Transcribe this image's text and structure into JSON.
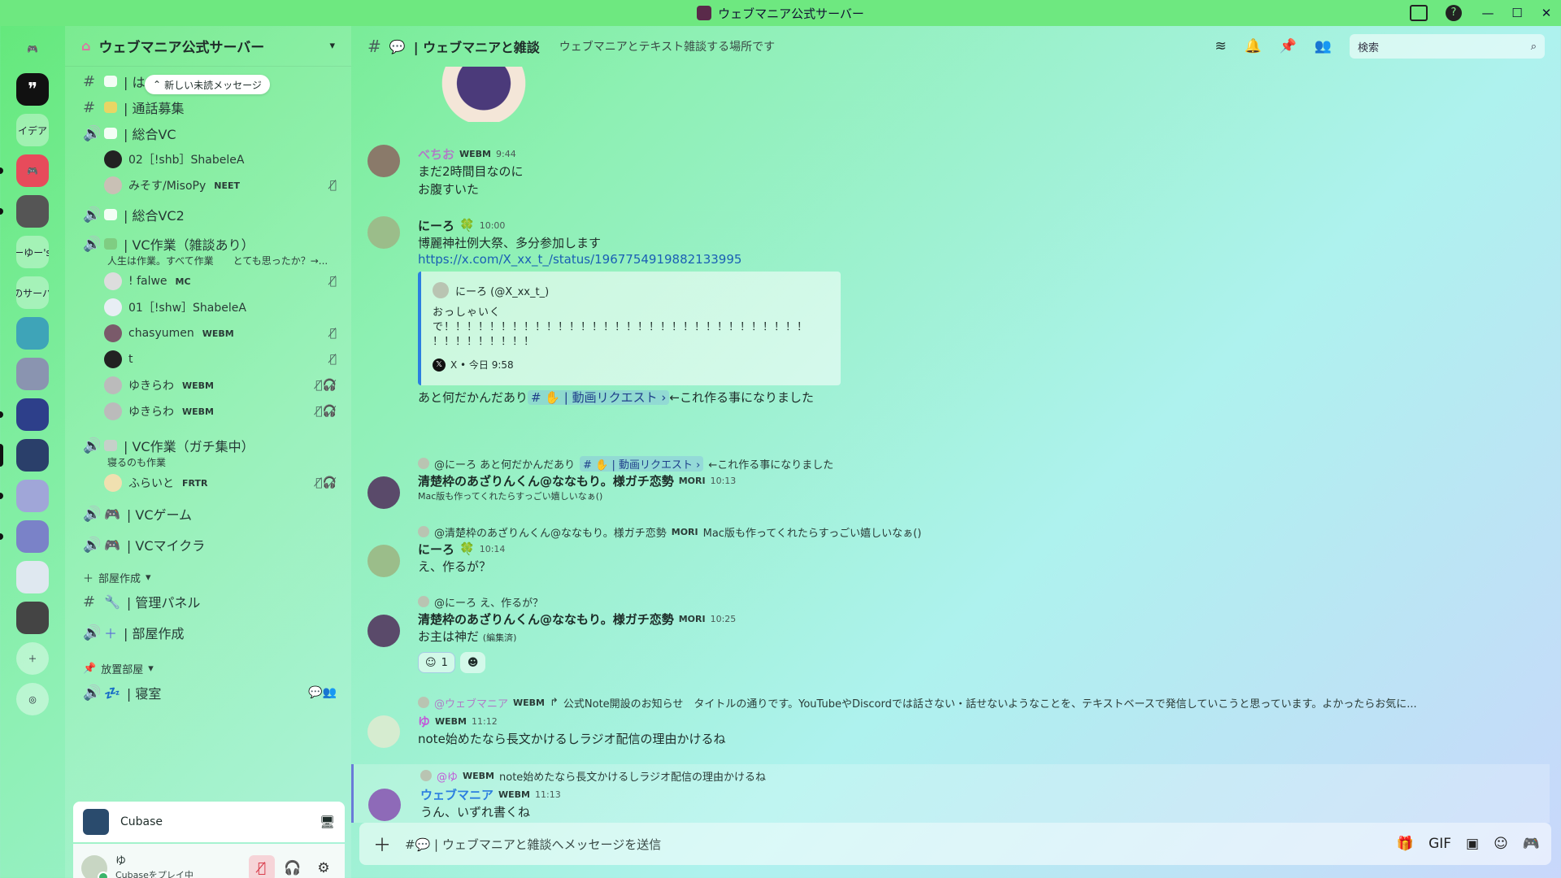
{
  "window": {
    "title": "ウェブマニア公式サーバー"
  },
  "rail": {
    "items": [
      "イデア",
      "ーゆー's",
      "のサーバ"
    ]
  },
  "server": {
    "name": "ウェブマニア公式サーバー",
    "unread_pill": "新しい未読メッセージ"
  },
  "channels": [
    {
      "type": "text",
      "label": "| は"
    },
    {
      "type": "text",
      "label": "| 通話募集"
    },
    {
      "type": "voice",
      "label": "| 総合VC"
    },
    {
      "type": "voice",
      "label": "| 総合VC2"
    },
    {
      "type": "voice",
      "label": "| VC作業（雑談あり）",
      "status": "人生は作業。すべて作業　　とても思ったか？→..."
    },
    {
      "type": "voice",
      "label": "| VC作業（ガチ集中）",
      "status": "寝るのも作業"
    },
    {
      "type": "voice",
      "label": "| VCゲーム"
    },
    {
      "type": "voice",
      "label": "| VCマイクラ"
    },
    {
      "type": "text",
      "label": "| 管理パネル"
    },
    {
      "type": "voice",
      "label": "| 部屋作成"
    },
    {
      "type": "voice",
      "label": "| 寝室"
    }
  ],
  "voice_users": {
    "vc1": [
      {
        "name": "02［!shb］ShabeleA",
        "tag": ""
      },
      {
        "name": "みそす/MisoPy",
        "tag": "NEET"
      }
    ],
    "vc3": [
      {
        "name": "! falwe",
        "tag": "MC"
      },
      {
        "name": "01［!shw］ShabeleA",
        "tag": ""
      },
      {
        "name": "chasyumen",
        "tag": "WEBM"
      },
      {
        "name": "t",
        "tag": ""
      },
      {
        "name": "ゆきらわ",
        "tag": "WEBM"
      },
      {
        "name": "ゆきらわ",
        "tag": "WEBM"
      }
    ],
    "vc4": [
      {
        "name": "ふらいと",
        "tag": "FRTR"
      }
    ]
  },
  "categories": {
    "room_create": "部屋作成",
    "free": "放置部屋"
  },
  "activity": {
    "app": "Cubase"
  },
  "user": {
    "name": "ゆ",
    "status": "Cubaseをプレイ中"
  },
  "topbar": {
    "channel": "| ウェブマニアと雑談",
    "topic": "ウェブマニアとテキスト雑談する場所です",
    "search_placeholder": "検索"
  },
  "messages": [
    {
      "author": "べちお",
      "badge": "WEBM",
      "time": "9:44",
      "lines": [
        "まだ2時間目なのに",
        "お腹すいた"
      ]
    },
    {
      "author": "にーろ",
      "time": "10:00",
      "lines": [
        "博麗神社例大祭、多分参加します"
      ],
      "link": "https://x.com/X_xx_t_/status/1967754919882133995",
      "embed": {
        "author": "にーろ (@X_xx_t_)",
        "text1": "おっしゃいく",
        "text2": "で！！！！！！！！！！！！！！！！！！！！！！！！！！！！！！！！",
        "text3": "！！！！！！！！！",
        "footer": "X • 今日 9:58"
      },
      "after_pre": "あと何だかんだあり",
      "after_mention": "# ✋ | 動画リクエスト ›",
      "after_post": "←これ作る事になりました"
    },
    {
      "reply": "@にーろ あと何だかんだあり",
      "reply_mention": "# ✋ | 動画リクエスト ›",
      "reply_post": "←これ作る事になりました",
      "author": "清楚枠のあざりんくん@ななもり。様ガチ恋勢",
      "badge": "MORI",
      "time": "10:13",
      "lines": [
        "Mac版も作ってくれたらすっごい嬉しいなぁ()"
      ]
    },
    {
      "reply": "@清楚枠のあざりんくん@ななもり。様ガチ恋勢",
      "reply_badge": "MORI",
      "reply_post": "Mac版も作ってくれたらすっごい嬉しいなぁ()",
      "author": "にーろ",
      "time": "10:14",
      "lines": [
        "え、作るが？"
      ]
    },
    {
      "reply": "@にーろ え、作るが？",
      "author": "清楚枠のあざりんくん@ななもり。様ガチ恋勢",
      "badge": "MORI",
      "time": "10:25",
      "lines": [
        "お主は神だ"
      ],
      "edited": "(編集済)",
      "reaction_count": "1"
    },
    {
      "reply": "@ウェブマニア",
      "reply_badge": "WEBM",
      "reply_post": "公式Note開設のお知らせ　タイトルの通りです。YouTubeやDiscordでは話さない・話せないようなことを、テキストベースで発信していこうと思っています。よかったらお気に...",
      "author": "ゆ",
      "badge": "WEBM",
      "time": "11:12",
      "lines": [
        "note始めたなら長文かけるしラジオ配信の理由かけるね"
      ]
    },
    {
      "reply": "@ゆ",
      "reply_badge": "WEBM",
      "reply_post": "note始めたなら長文かけるしラジオ配信の理由かけるね",
      "author": "ウェブマニア",
      "badge": "WEBM",
      "time": "11:13",
      "lines": [
        "うん、いずれ書くね"
      ]
    }
  ],
  "composer": {
    "placeholder": "#💬 | ウェブマニアと雑談へメッセージを送信"
  },
  "colors": {
    "accent": "#2b7ee0",
    "titlebar": "#6ee880"
  }
}
